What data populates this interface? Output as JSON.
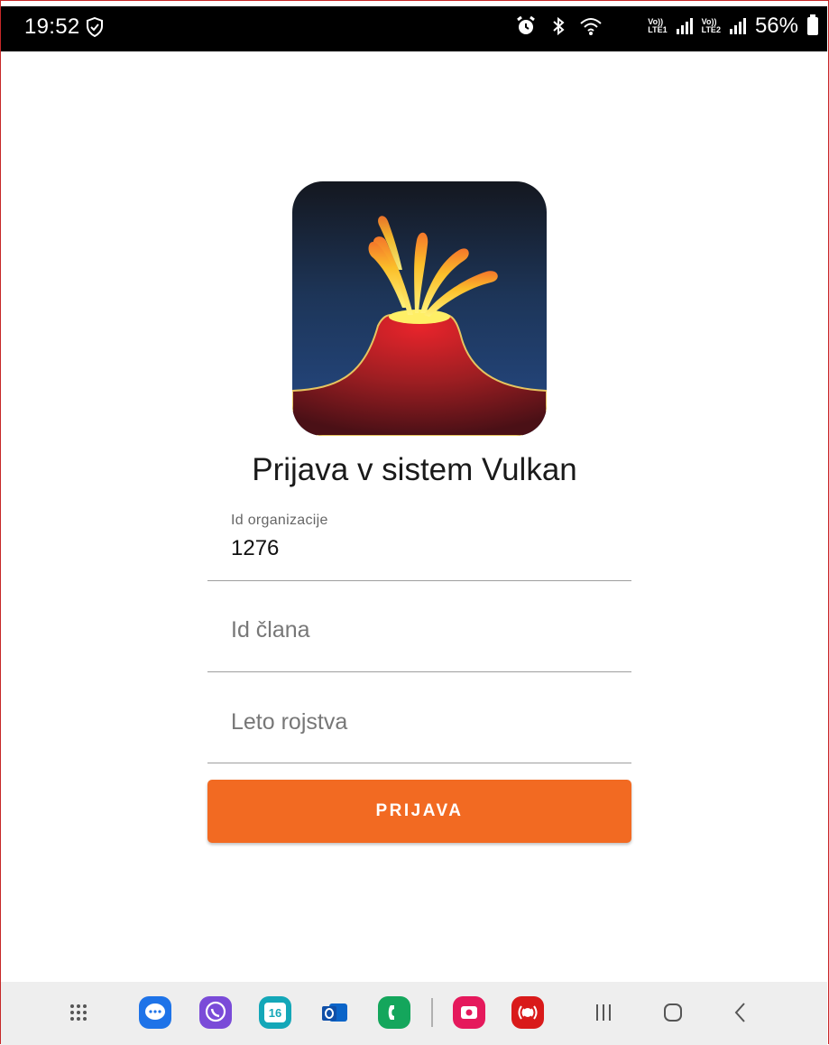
{
  "status_bar": {
    "time": "19:52",
    "battery": "56%",
    "icons": [
      "shield-check-icon",
      "alarm-icon",
      "bluetooth-icon",
      "wifi-icon",
      "volte-lte1-signal-icon",
      "volte-lte2-signal-icon",
      "battery-icon"
    ],
    "sim1": [
      "Vo))",
      "LTE1"
    ],
    "sim2": [
      "Vo))",
      "LTE2"
    ]
  },
  "app": {
    "logo": "volcano-logo",
    "title": "Prijava v sistem Vulkan"
  },
  "form": {
    "org_field": {
      "label": "Id organizacije",
      "value": "1276"
    },
    "member_field": {
      "placeholder": "Id člana",
      "value": ""
    },
    "birth_year_field": {
      "placeholder": "Leto rojstva",
      "value": ""
    },
    "submit_label": "PRIJAVA"
  },
  "colors": {
    "accent": "#f26a22",
    "status_bar": "#000000",
    "nav_bar": "#eeeeee"
  },
  "nav_bar": {
    "calendar_day": "16",
    "apps": [
      "app-drawer-icon",
      "messages-icon",
      "viber-icon",
      "calendar-icon",
      "outlook-icon",
      "phone-icon",
      "screen-recorder-icon",
      "emergency-alerts-icon"
    ],
    "system": [
      "recents-icon",
      "home-icon",
      "back-icon"
    ]
  }
}
